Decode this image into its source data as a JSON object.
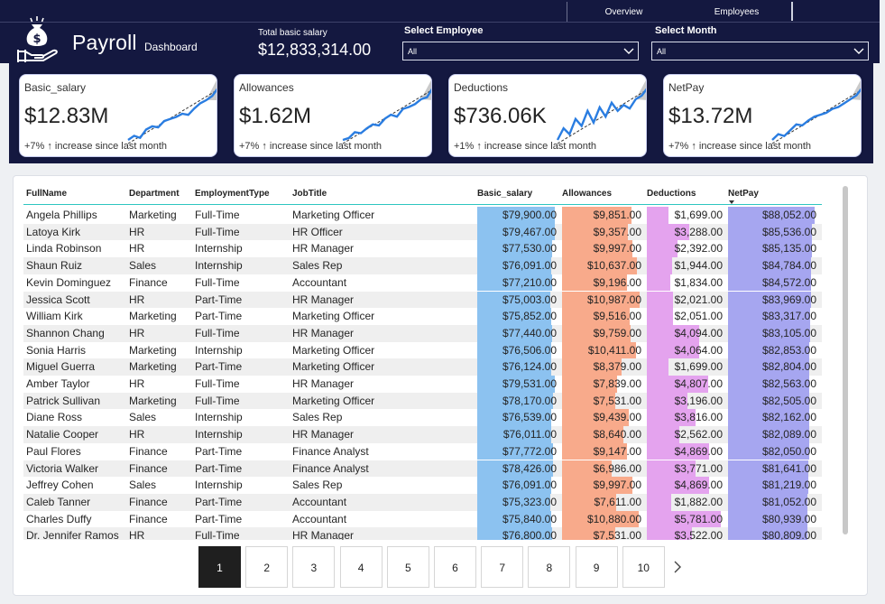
{
  "header": {
    "app_title": "Payroll",
    "app_subtitle": "Dashboard",
    "nav_tabs": [
      "Overview",
      "Employees"
    ],
    "total_label": "Total basic salary",
    "total_value": "$12,833,314.00",
    "employee_slicer": {
      "label": "Select Employee",
      "value": "All"
    },
    "month_slicer": {
      "label": "Select Month",
      "value": "All"
    },
    "logo_icon": "money-bag-hand-icon"
  },
  "kpis": [
    {
      "title": "Basic_salary",
      "value": "$12.83M",
      "trend": "+7% ↑ increase since last month",
      "spark": [
        20,
        24,
        22,
        30,
        33,
        32,
        38,
        40,
        42,
        45,
        44,
        50,
        55,
        58,
        62,
        70
      ]
    },
    {
      "title": "Allowances",
      "value": "$1.62M",
      "trend": "+7% ↑ increase since last month",
      "spark": [
        18,
        20,
        26,
        25,
        30,
        34,
        33,
        40,
        44,
        42,
        50,
        52,
        55,
        60,
        62,
        72
      ]
    },
    {
      "title": "Deductions",
      "value": "$736.06K",
      "trend": "+1% ↑ increase since last month",
      "spark": [
        30,
        40,
        35,
        48,
        42,
        55,
        45,
        58,
        50,
        62,
        55,
        60,
        57,
        65,
        68,
        75
      ]
    },
    {
      "title": "NetPay",
      "value": "$13.72M",
      "trend": "+7% ↑ increase since last month",
      "spark": [
        18,
        24,
        22,
        28,
        34,
        33,
        38,
        42,
        44,
        46,
        50,
        52,
        56,
        60,
        64,
        72
      ]
    }
  ],
  "table": {
    "columns": [
      "FullName",
      "Department",
      "EmploymentType",
      "JobTitle",
      "Basic_salary",
      "Allowances",
      "Deductions",
      "NetPay"
    ],
    "rows": [
      [
        "Angela Phillips",
        "Marketing",
        "Full-Time",
        "Marketing Officer",
        "$79,900.00",
        "$9,851.00",
        "$1,699.00",
        "$88,052.00"
      ],
      [
        "Latoya Kirk",
        "HR",
        "Full-Time",
        "HR Officer",
        "$79,467.00",
        "$9,357.00",
        "$3,288.00",
        "$85,536.00"
      ],
      [
        "Linda Robinson",
        "HR",
        "Internship",
        "HR Manager",
        "$77,530.00",
        "$9,997.00",
        "$2,392.00",
        "$85,135.00"
      ],
      [
        "Shaun Ruiz",
        "Sales",
        "Internship",
        "Sales Rep",
        "$76,091.00",
        "$10,637.00",
        "$1,944.00",
        "$84,784.00"
      ],
      [
        "Kevin Dominguez",
        "Finance",
        "Full-Time",
        "Accountant",
        "$77,210.00",
        "$9,196.00",
        "$1,834.00",
        "$84,572.00"
      ],
      [
        "Jessica Scott",
        "HR",
        "Part-Time",
        "HR Manager",
        "$75,003.00",
        "$10,987.00",
        "$2,021.00",
        "$83,969.00"
      ],
      [
        "William Kirk",
        "Marketing",
        "Part-Time",
        "Marketing Officer",
        "$75,852.00",
        "$9,516.00",
        "$2,051.00",
        "$83,317.00"
      ],
      [
        "Shannon Chang",
        "HR",
        "Full-Time",
        "HR Manager",
        "$77,440.00",
        "$9,759.00",
        "$4,094.00",
        "$83,105.00"
      ],
      [
        "Sonia Harris",
        "Marketing",
        "Internship",
        "Marketing Officer",
        "$76,506.00",
        "$10,411.00",
        "$4,064.00",
        "$82,853.00"
      ],
      [
        "Miguel Guerra",
        "Marketing",
        "Part-Time",
        "Marketing Officer",
        "$76,124.00",
        "$8,379.00",
        "$1,699.00",
        "$82,804.00"
      ],
      [
        "Amber Taylor",
        "HR",
        "Full-Time",
        "HR Manager",
        "$79,531.00",
        "$7,839.00",
        "$4,807.00",
        "$82,563.00"
      ],
      [
        "Patrick Sullivan",
        "Marketing",
        "Full-Time",
        "Marketing Officer",
        "$78,170.00",
        "$7,531.00",
        "$3,196.00",
        "$82,505.00"
      ],
      [
        "Diane Ross",
        "Sales",
        "Internship",
        "Sales Rep",
        "$76,539.00",
        "$9,439.00",
        "$3,816.00",
        "$82,162.00"
      ],
      [
        "Natalie Cooper",
        "HR",
        "Internship",
        "HR Manager",
        "$76,011.00",
        "$8,640.00",
        "$2,562.00",
        "$82,089.00"
      ],
      [
        "Paul Flores",
        "Finance",
        "Part-Time",
        "Finance Analyst",
        "$77,772.00",
        "$9,147.00",
        "$4,869.00",
        "$82,050.00"
      ],
      [
        "Victoria Walker",
        "Finance",
        "Part-Time",
        "Finance Analyst",
        "$78,426.00",
        "$6,986.00",
        "$3,771.00",
        "$81,641.00"
      ],
      [
        "Jeffrey Cohen",
        "Sales",
        "Internship",
        "Sales Rep",
        "$76,091.00",
        "$9,997.00",
        "$4,869.00",
        "$81,219.00"
      ],
      [
        "Caleb Tanner",
        "Finance",
        "Part-Time",
        "Accountant",
        "$75,323.00",
        "$7,611.00",
        "$1,882.00",
        "$81,052.00"
      ],
      [
        "Charles Duffy",
        "Finance",
        "Part-Time",
        "Accountant",
        "$75,840.00",
        "$10,880.00",
        "$5,781.00",
        "$80,939.00"
      ],
      [
        "Dr. Jennifer Ramos",
        "HR",
        "Full-Time",
        "HR Manager",
        "$76,800.00",
        "$7,531.00",
        "$3,522.00",
        "$80,809.00"
      ]
    ],
    "bar_colors": {
      "Basic_salary": "#8cc2f0",
      "Allowances": "#f8aa8b",
      "Deductions": "#e4a3ee",
      "NetPay": "#a6a6f0"
    },
    "sort_column": "NetPay"
  },
  "pager": {
    "pages": [
      "1",
      "2",
      "3",
      "4",
      "5",
      "6",
      "7",
      "8",
      "9",
      "10"
    ],
    "active_page": "1",
    "next_icon": "chevron-right-icon"
  }
}
